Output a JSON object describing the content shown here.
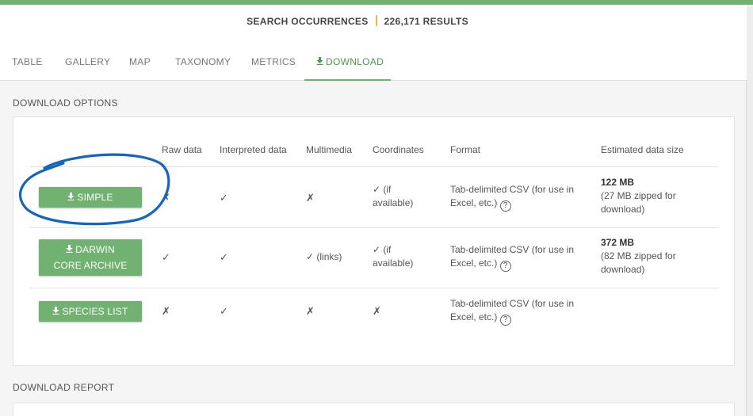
{
  "summary": {
    "label": "SEARCH OCCURRENCES",
    "count": "226,171 RESULTS"
  },
  "tabs": [
    {
      "label": "TABLE"
    },
    {
      "label": "GALLERY"
    },
    {
      "label": "MAP"
    },
    {
      "label": "TAXONOMY"
    },
    {
      "label": "METRICS"
    },
    {
      "label": "DOWNLOAD",
      "icon": "download-icon",
      "active": true
    }
  ],
  "download_options": {
    "title": "DOWNLOAD OPTIONS",
    "headers": [
      "Raw data",
      "Interpreted data",
      "Multimedia",
      "Coordinates",
      "Format",
      "Estimated data size"
    ],
    "rows": [
      {
        "button": "SIMPLE",
        "raw": "✗",
        "interpreted": "✓",
        "multimedia": "✗",
        "coordinates": "✓ (if available)",
        "format": "Tab-delimited CSV (for use in Excel, etc.)",
        "size_main": "122 MB",
        "size_sub": "(27 MB zipped for download)"
      },
      {
        "button": "DARWIN CORE ARCHIVE",
        "raw": "✓",
        "interpreted": "✓",
        "multimedia": "✓ (links)",
        "coordinates": "✓ (if available)",
        "format": "Tab-delimited CSV (for use in Excel, etc.)",
        "size_main": "372 MB",
        "size_sub": "(82 MB zipped for download)"
      },
      {
        "button": "SPECIES LIST",
        "raw": "✗",
        "interpreted": "✓",
        "multimedia": "✗",
        "coordinates": "✗",
        "format": "Tab-delimited CSV (for use in Excel, etc.)",
        "size_main": "",
        "size_sub": ""
      }
    ],
    "help_glyph": "?"
  },
  "download_report": {
    "title": "DOWNLOAD REPORT"
  },
  "icons": {
    "download": "download-icon",
    "help": "help-circle-icon",
    "annotation": "annotation-circle"
  },
  "colors": {
    "accent": "#71b171",
    "active_tab": "#4a9a4a",
    "separator": "#e8b84a",
    "annotation": "#1565c0"
  }
}
